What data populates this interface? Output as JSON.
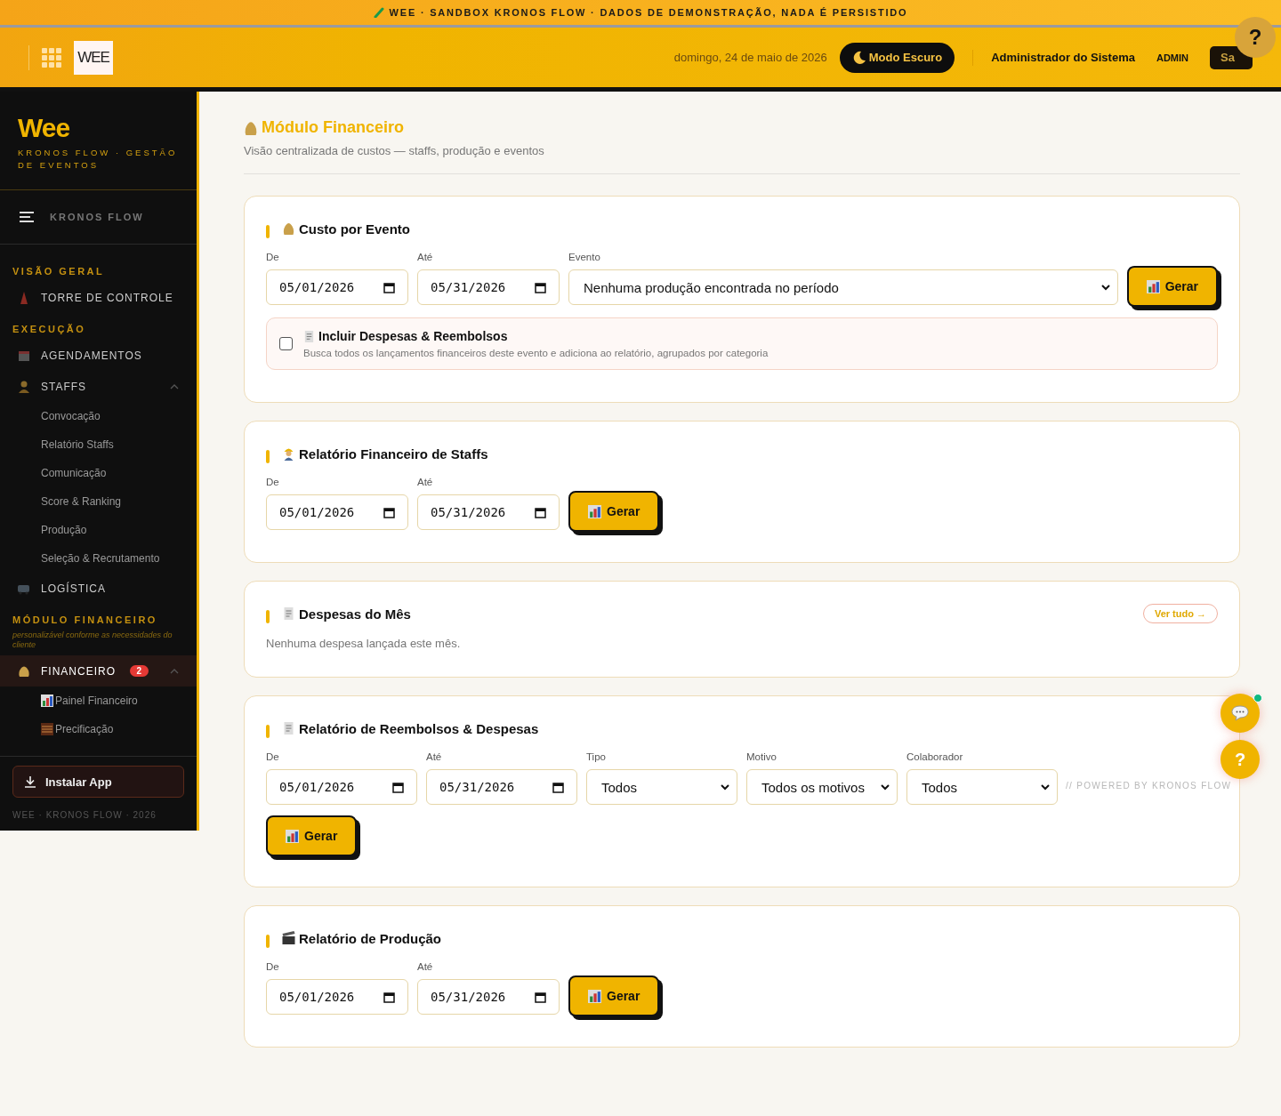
{
  "banner": {
    "text": "WEE · SANDBOX KRONOS FLOW · DADOS DE DEMONSTRAÇÃO, NADA É PERSISTIDO"
  },
  "header": {
    "logo": "WEE",
    "date": "domingo, 24 de maio de 2026",
    "dark_mode_button": "Modo Escuro",
    "user_name": "Administrador do Sistema",
    "role": "ADMIN",
    "logout_button": "Sa",
    "help_button": "?"
  },
  "sidebar": {
    "brand": "Wee",
    "tagline": "KRONOS FLOW · GESTÃO DE EVENTOS",
    "toggle_label": "KRONOS FLOW",
    "sections": [
      {
        "title": "VISÃO GERAL",
        "items": [
          {
            "label": "TORRE DE CONTROLE",
            "selected": false
          }
        ]
      },
      {
        "title": "EXECUÇÃO",
        "items": [
          {
            "label": "AGENDAMENTOS",
            "selected": false
          },
          {
            "label": "STAFFS",
            "selected": false,
            "expanded": true,
            "children": [
              {
                "label": "Convocação"
              },
              {
                "label": "Relatório Staffs"
              },
              {
                "label": "Comunicação"
              },
              {
                "label": "Score & Ranking"
              },
              {
                "label": "Produção"
              },
              {
                "label": "Seleção & Recrutamento"
              }
            ]
          },
          {
            "label": "LOGÍSTICA",
            "selected": false
          }
        ]
      },
      {
        "title": "MÓDULO FINANCEIRO",
        "subtitle": "personalizável conforme as necessidades do cliente",
        "items": [
          {
            "label": "FINANCEIRO",
            "selected": true,
            "badge": "2",
            "expanded": true,
            "children": [
              {
                "label": "Painel Financeiro"
              },
              {
                "label": "Precificação"
              }
            ]
          }
        ]
      }
    ],
    "install_button": "Instalar App",
    "footer": "WEE · KRONOS FLOW · 2026"
  },
  "main": {
    "title": "Módulo Financeiro",
    "subtitle": "Visão centralizada de custos — staffs, produção e eventos",
    "cards": [
      {
        "kind": "form",
        "title": "Custo por Evento",
        "fields": [
          {
            "label": "De",
            "kind": "date",
            "value": "05/01/2026"
          },
          {
            "label": "Até",
            "kind": "date",
            "value": "05/31/2026"
          },
          {
            "label": "Evento",
            "kind": "select",
            "value": "Nenhuma produção encontrada no período"
          }
        ],
        "button": "Gerar",
        "option": {
          "title": "Incluir Despesas & Reembolsos",
          "description": "Busca todos os lançamentos financeiros deste evento e adiciona ao relatório, agrupados por categoria",
          "checked": false
        }
      },
      {
        "kind": "form",
        "title": "Relatório Financeiro de Staffs",
        "fields": [
          {
            "label": "De",
            "kind": "date",
            "value": "05/01/2026"
          },
          {
            "label": "Até",
            "kind": "date",
            "value": "05/31/2026"
          }
        ],
        "button": "Gerar"
      },
      {
        "kind": "list",
        "title": "Despesas do Mês",
        "link": "Ver tudo →",
        "empty_text": "Nenhuma despesa lançada este mês."
      },
      {
        "kind": "wide_form",
        "title": "Relatório de Reembolsos & Despesas",
        "fields": [
          {
            "label": "De",
            "kind": "date",
            "value": "05/01/2026"
          },
          {
            "label": "Até",
            "kind": "date",
            "value": "05/31/2026"
          },
          {
            "label": "Tipo",
            "kind": "select",
            "value": "Todos"
          },
          {
            "label": "Motivo",
            "kind": "select",
            "value": "Todos os motivos"
          },
          {
            "label": "Colaborador",
            "kind": "select",
            "value": "Todos"
          }
        ],
        "button": "Gerar"
      },
      {
        "kind": "form",
        "title": "Relatório de Produção",
        "fields": [
          {
            "label": "De",
            "kind": "date",
            "value": "05/01/2026"
          },
          {
            "label": "Até",
            "kind": "date",
            "value": "05/31/2026"
          }
        ],
        "button": "Gerar"
      }
    ]
  },
  "floating": {
    "chat_online": true,
    "help_button": "?",
    "powered_by": "// POWERED BY KRONOS FLOW"
  }
}
